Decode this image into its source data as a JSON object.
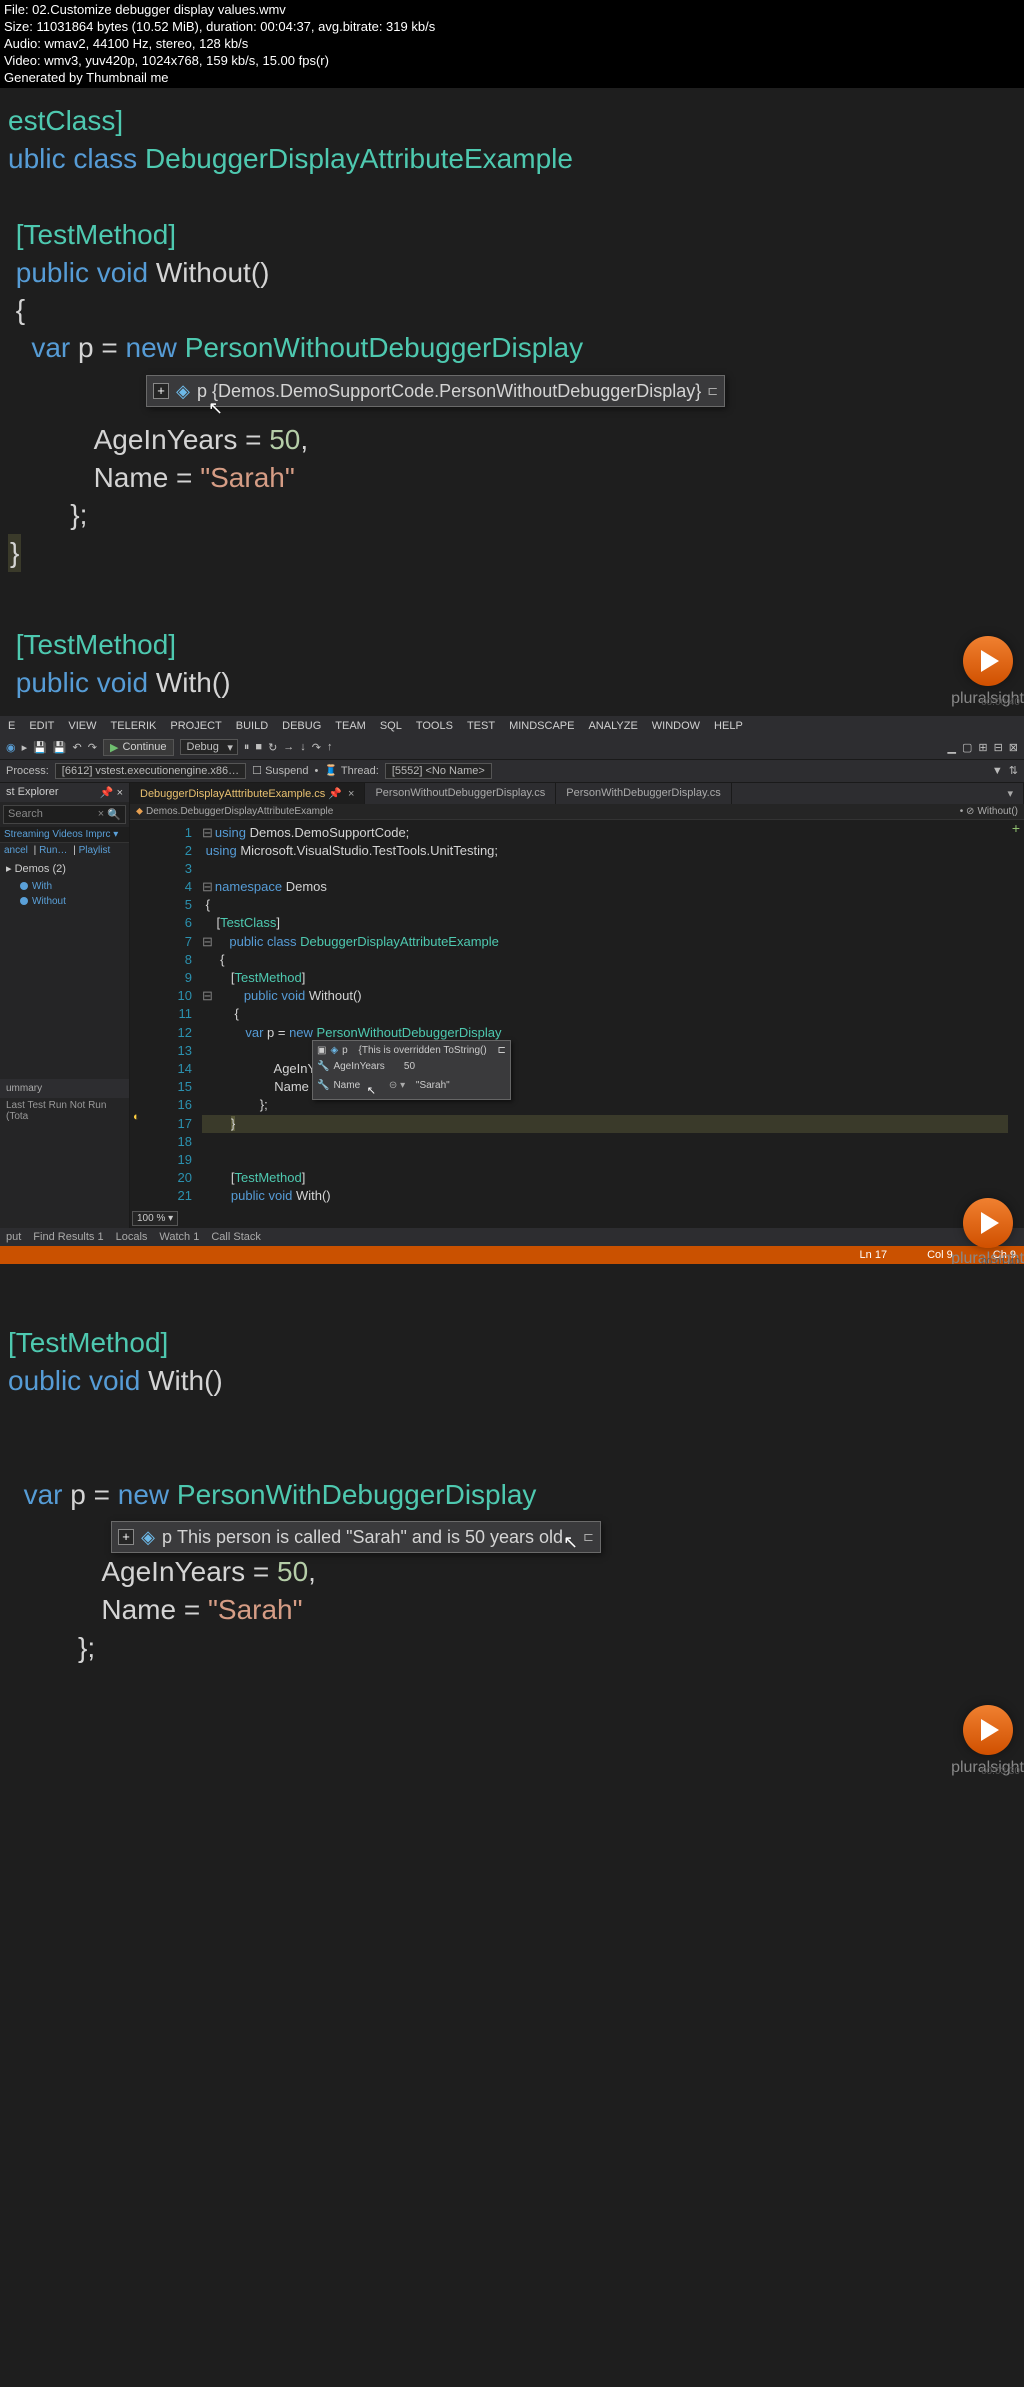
{
  "fileinfo": {
    "l1": "File: 02.Customize debugger display values.wmv",
    "l2": "Size: 11031864 bytes (10.52 MiB), duration: 00:04:37, avg.bitrate: 319 kb/s",
    "l3": "Audio: wmav2, 44100 Hz, stereo, 128 kb/s",
    "l4": "Video: wmv3, yuv420p, 1024x768, 159 kb/s, 15.00 fps(r)",
    "l5": "Generated by Thumbnail me"
  },
  "panel1": {
    "testclass": "estClass]",
    "pubclass_pre": "ublic class ",
    "classname": "DebuggerDisplayAttributeExample",
    "testmethod": "[TestMethod]",
    "pubvoid": "public void ",
    "method": "Without",
    "paren": "()",
    "brace": "{",
    "var": "var",
    "p": "p",
    "eq": "= ",
    "new": "new",
    "type": "PersonWithoutDebuggerDisplay",
    "tip_p": "p",
    "tip_val": "{Demos.DemoSupportCode.PersonWithoutDebuggerDisplay}",
    "age": "AgeInYears = ",
    "agev": "50",
    "comma": ",",
    "name": "Name = ",
    "namev": "\"Sarah\"",
    "cbrace": "};",
    "endbrace": "}"
  },
  "panel2": {
    "testmethod": "[TestMethod]",
    "pubvoid": "public void ",
    "method": "With",
    "paren": "()",
    "brand": "pluralsight",
    "timecode": "00:00:40"
  },
  "ide": {
    "menu": [
      "E",
      "EDIT",
      "VIEW",
      "TELERIK",
      "PROJECT",
      "BUILD",
      "DEBUG",
      "TEAM",
      "SQL",
      "TOOLS",
      "TEST",
      "MINDSCAPE",
      "ANALYZE",
      "WINDOW",
      "HELP"
    ],
    "continue": "Continue",
    "config": "Debug",
    "process_lbl": "Process:",
    "process_val": "[6612] vstest.executionengine.x86…",
    "suspend": "Suspend",
    "thread_lbl": "Thread:",
    "thread_val": "[5552] <No Name>",
    "explorer_title": "st Explorer",
    "search_placeholder": "Search",
    "streaming": "Streaming Videos Imprc",
    "links": [
      "ancel",
      "Run…",
      "Playlist"
    ],
    "demos_group": "Demos (2)",
    "tests": [
      "With",
      "Without"
    ],
    "summary": "ummary",
    "lastrun": "Last Test Run Not Run (Tota",
    "tabs": [
      "DebuggerDisplayAtttributeExample.cs",
      "PersonWithoutDebuggerDisplay.cs",
      "PersonWithDebuggerDisplay.cs"
    ],
    "bc1": "Demos.DebuggerDisplayAttributeExample",
    "bc2": "Without()",
    "lines": {
      "1": [
        "using",
        " Demos.DemoSupportCode;"
      ],
      "2": [
        "using",
        " Microsoft.VisualStudio.TestTools.UnitTesting;"
      ],
      "4": [
        "namespace",
        " Demos"
      ],
      "5": [
        "{"
      ],
      "6": [
        "    [",
        "TestClass",
        "]"
      ],
      "7": [
        "    ",
        "public class ",
        "DebuggerDisplayAttributeExample"
      ],
      "8": [
        "    {"
      ],
      "9": [
        "        [",
        "TestMethod",
        "]"
      ],
      "10": [
        "        ",
        "public void ",
        "Without",
        "()"
      ],
      "11": [
        "        {"
      ],
      "12": [
        "            ",
        "var",
        " p = ",
        "new ",
        "PersonWithoutDebuggerDisplay"
      ],
      "13a": [
        "                "
      ],
      "14": [
        "                    AgeInYears = ",
        "50",
        ","
      ],
      "15": [
        "                    Name = ",
        "\"Sarah\""
      ],
      "16": [
        "                };"
      ],
      "17": [
        "        ",
        "}"
      ],
      "20": [
        "        [",
        "TestMethod",
        "]"
      ],
      "21": [
        "        ",
        "public void ",
        "With",
        "()"
      ]
    },
    "innertip": {
      "head_p": "p",
      "head_val": "{This is overridden ToString()",
      "age_lbl": "AgeInYears",
      "age_val": "50",
      "name_lbl": "Name",
      "name_val": "\"Sarah\""
    },
    "zoom": "100 %",
    "bottomtabs": [
      "put",
      "Find Results 1",
      "Locals",
      "Watch 1",
      "Call Stack"
    ],
    "status": {
      "ln": "Ln 17",
      "col": "Col 9",
      "ch": "Ch 9"
    },
    "brand": "pluralsight",
    "timecode": "00:01:40"
  },
  "panel3": {
    "testmethod": "[TestMethod]",
    "pubvoid": "oublic void ",
    "method": "With",
    "paren": "()",
    "var": "var",
    "p": "p",
    "eq": "= ",
    "new": "new",
    "type": "PersonWithDebuggerDisplay",
    "tip_p": "p",
    "tip_val": "This person is called \"Sarah\" and is 50 years old",
    "age": "AgeInYears = ",
    "agev": "50",
    "comma": ",",
    "name": "Name = ",
    "namev": "\"Sarah\"",
    "cbrace": "};",
    "brand": "pluralsight",
    "timecode": "00:03:30"
  }
}
